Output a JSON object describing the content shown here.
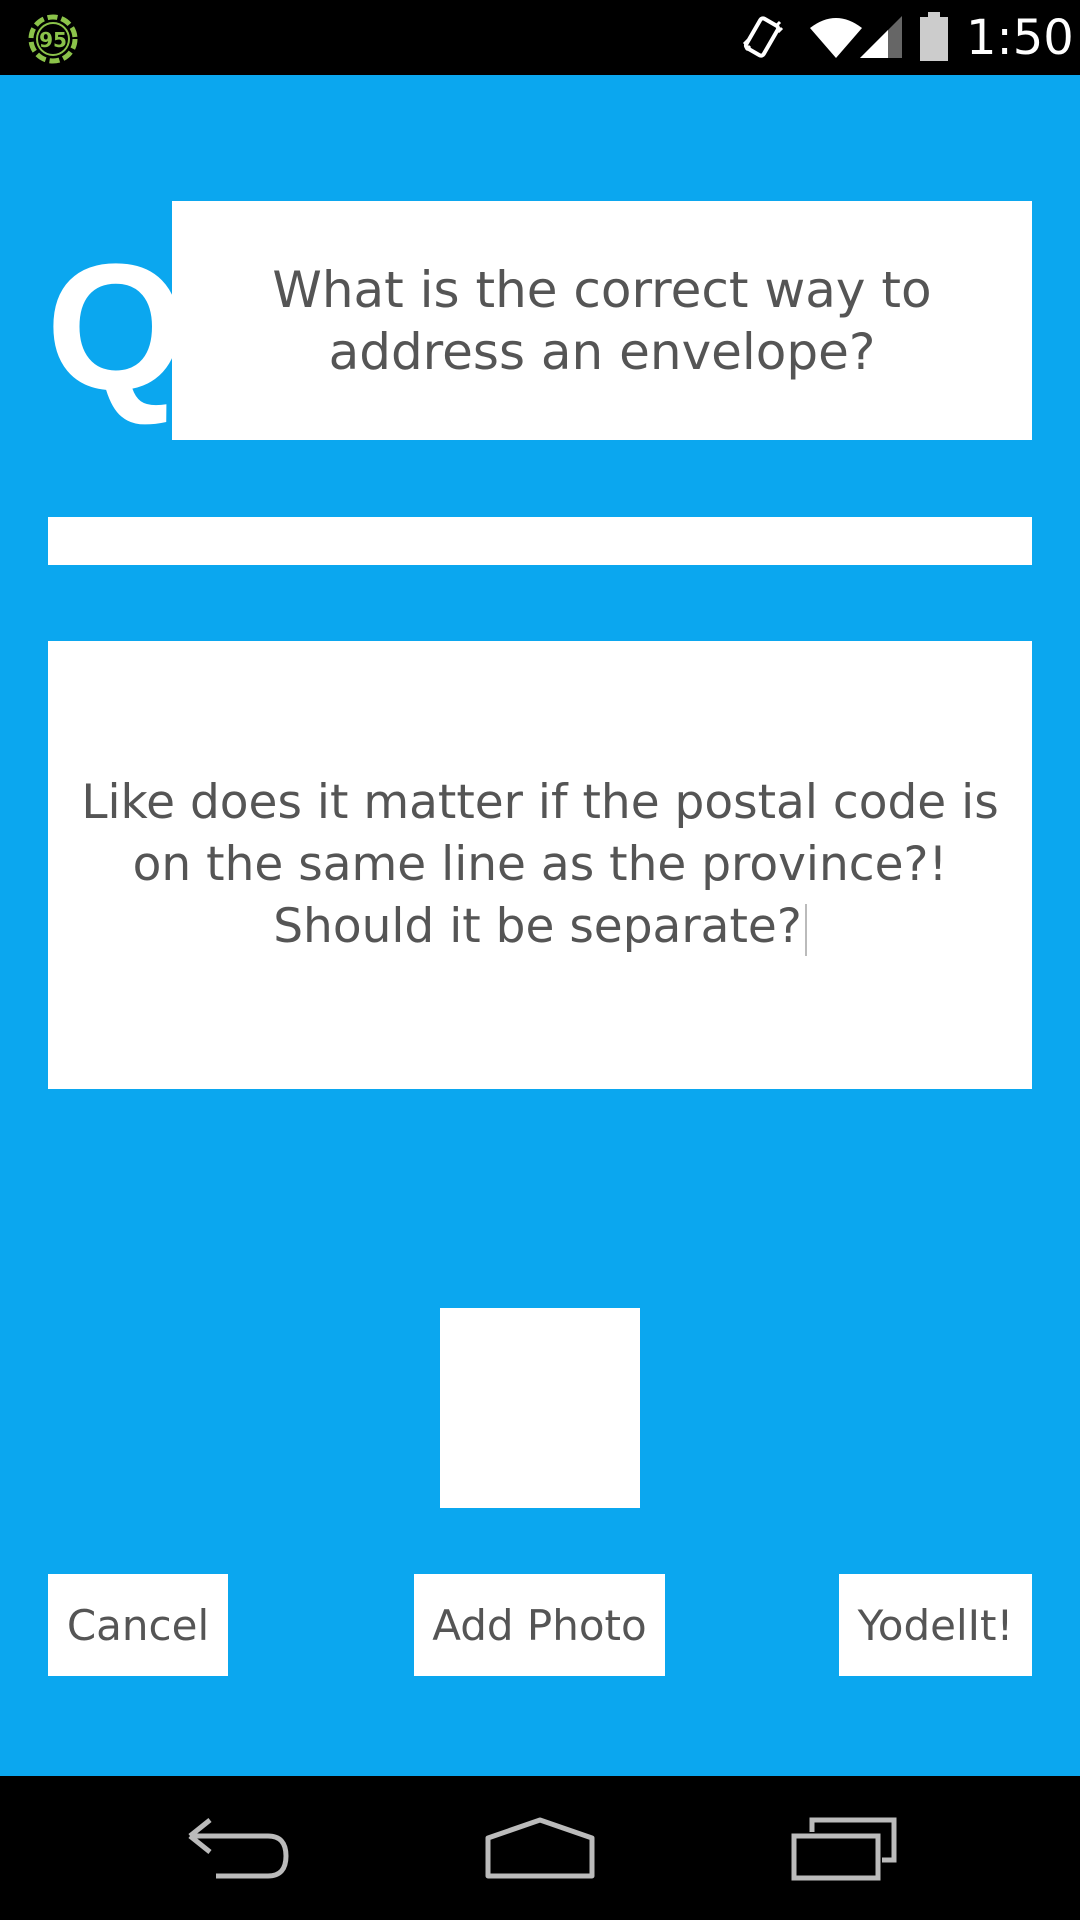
{
  "status_bar": {
    "notification_badge": "95",
    "time": "1:50",
    "icons": [
      "notification-badge-icon",
      "vibrate-icon",
      "wifi-icon",
      "signal-icon",
      "battery-icon"
    ]
  },
  "question": {
    "prefix_letter": "Q",
    "title": "What is the correct way to address an envelope?"
  },
  "tags_field": {
    "value": ""
  },
  "details": {
    "text": "Like does it matter if the postal code is on the same line as the province?! Should it be separate?"
  },
  "actions": {
    "cancel_label": "Cancel",
    "add_photo_label": "Add Photo",
    "submit_label": "YodelIt!"
  },
  "nav_bar": {
    "icons": [
      "back-icon",
      "home-icon",
      "recents-icon"
    ]
  },
  "colors": {
    "background": "#0ba7ef",
    "panel": "#ffffff",
    "text": "#555555",
    "bars": "#000000",
    "badge_green": "#8bc34a"
  }
}
